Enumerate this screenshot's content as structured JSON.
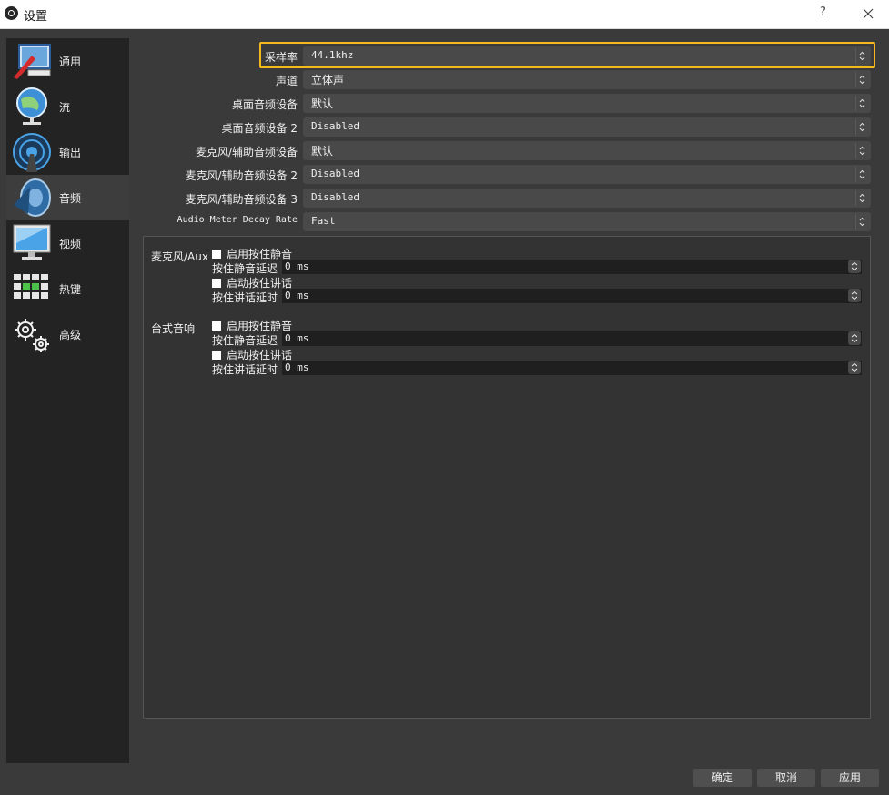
{
  "window": {
    "title": "设置",
    "help": "?",
    "close": "✕"
  },
  "sidebar": {
    "items": [
      {
        "label": "通用",
        "icon": "general-icon",
        "active": false
      },
      {
        "label": "流",
        "icon": "stream-icon",
        "active": false
      },
      {
        "label": "输出",
        "icon": "output-icon",
        "active": false
      },
      {
        "label": "音频",
        "icon": "audio-icon",
        "active": true
      },
      {
        "label": "视频",
        "icon": "video-icon",
        "active": false
      },
      {
        "label": "热键",
        "icon": "hotkeys-icon",
        "active": false
      },
      {
        "label": "高级",
        "icon": "advanced-icon",
        "active": false
      }
    ]
  },
  "audio": {
    "sample_rate": {
      "label": "采样率",
      "value": "44.1khz"
    },
    "channels": {
      "label": "声道",
      "value": "立体声"
    },
    "desktop_device": {
      "label": "桌面音频设备",
      "value": "默认"
    },
    "desktop_device_2": {
      "label": "桌面音频设备 2",
      "value": "Disabled"
    },
    "mic_device": {
      "label": "麦克风/辅助音频设备",
      "value": "默认"
    },
    "mic_device_2": {
      "label": "麦克风/辅助音频设备 2",
      "value": "Disabled"
    },
    "mic_device_3": {
      "label": "麦克风/辅助音频设备 3",
      "value": "Disabled"
    },
    "meter_decay": {
      "label": "Audio Meter Decay Rate",
      "value": "Fast"
    }
  },
  "hotkey_groups": [
    {
      "device": "麦克风/Aux",
      "push_to_mute": "启用按住静音",
      "push_to_mute_delay_label": "按住静音延迟",
      "push_to_mute_delay": "0  ms",
      "push_to_talk": "启动按住讲话",
      "push_to_talk_delay_label": "按住讲话延时",
      "push_to_talk_delay": "0  ms"
    },
    {
      "device": "台式音响",
      "push_to_mute": "启用按住静音",
      "push_to_mute_delay_label": "按住静音延迟",
      "push_to_mute_delay": "0  ms",
      "push_to_talk": "启动按住讲话",
      "push_to_talk_delay_label": "按住讲话延时",
      "push_to_talk_delay": "0  ms"
    }
  ],
  "footer": {
    "ok": "确定",
    "cancel": "取消",
    "apply": "应用"
  },
  "colors": {
    "highlight": "#f5b91e",
    "panel": "#3a3a3a",
    "sidebar": "#232323"
  }
}
